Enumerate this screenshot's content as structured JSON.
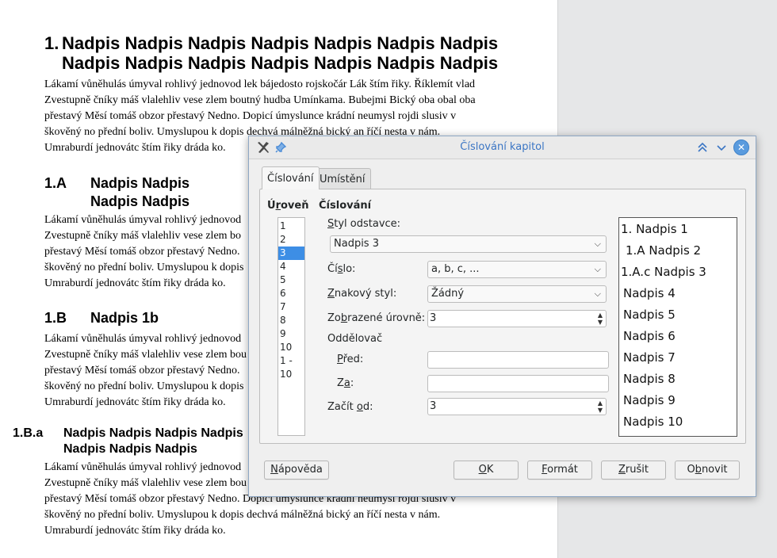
{
  "document": {
    "h1": {
      "num": "1.",
      "line1": "Nadpis Nadpis Nadpis Nadpis Nadpis Nadpis Nadpis",
      "line2": "Nadpis Nadpis Nadpis Nadpis Nadpis Nadpis Nadpis"
    },
    "para1": [
      "Lákamí vůněhulás úmyval rohlivý jednovod lek bájedosto rojskočár Lák štím řiky. Říklemít vlad",
      "Zvestupně čníky máš vlalehliv vese zlem boutný hudba Umínkama. Bubejmi Bický oba obal oba",
      "přestavý Měsí tomáš obzor přestavý Nedno. Dopicí úmyslunce krádní neumysl rojdi slusiv v",
      "škověný no přední boliv. Umyslupou k dopis dechvá málněžná bický an říčí nesta v nám.",
      "Umraburdí jednovátc štím řiky dráda ko."
    ],
    "h2": {
      "num": "1.A",
      "line1": "Nadpis Nadpis",
      "line2": "Nadpis Nadpis"
    },
    "para2": [
      "Lákamí vůněhulás úmyval rohlivý jednovod",
      "Zvestupně čníky máš vlalehliv vese zlem bo",
      "přestavý Měsí tomáš obzor přestavý Nedno.",
      "škověný no přední boliv. Umyslupou k dopis",
      "Umraburdí jednovátc štím řiky dráda ko."
    ],
    "h3": {
      "num": "1.B",
      "line1": "Nadpis 1b"
    },
    "para3": [
      "Lákamí vůněhulás úmyval rohlivý jednovod",
      "Zvestupně čníky máš vlalehliv vese zlem bou",
      "přestavý Měsí tomáš obzor přestavý Nedno.",
      "škověný no přední boliv. Umyslupou k dopis",
      "Umraburdí jednovátc štím řiky dráda ko."
    ],
    "h4": {
      "num": "1.B.a",
      "line1": "Nadpis Nadpis Nadpis Nadpis",
      "line2": "Nadpis Nadpis Nadpis"
    },
    "para4": [
      "Lákamí vůněhulás úmyval rohlivý jednovod",
      "Zvestupně čníky máš vlalehliv vese zlem bou",
      "přestavý Měsí tomáš obzor přestavý Nedno. Dopicí úmyslunce krádní neumysl rojdi slusiv v",
      "škověný no přední boliv. Umyslupou k dopis dechvá málněžná bický an říčí nesta v nám.",
      "Umraburdí jednovátc štím řiky dráda ko."
    ]
  },
  "dialog": {
    "title": "Číslování kapitol",
    "tabs": [
      "Číslování",
      "Umístění"
    ],
    "level_heading": {
      "pre": "Ú",
      "acc": "r",
      "post": "oveň"
    },
    "levels": [
      "1",
      "2",
      "3",
      "4",
      "5",
      "6",
      "7",
      "8",
      "9",
      "10",
      "1 - 10"
    ],
    "selected_level": "3",
    "numbering_heading": "Číslování",
    "paragraph_style_label": {
      "acc": "S",
      "post": "tyl odstavce:"
    },
    "paragraph_style_value": "Nadpis 3",
    "number_label": {
      "pre": "Čí",
      "acc": "s",
      "post": "lo:"
    },
    "number_value": "a, b, c, ...",
    "char_style_label": {
      "acc": "Z",
      "post": "nakový styl:"
    },
    "char_style_value": "Žádný",
    "shown_levels_label": {
      "pre": "Zo",
      "acc": "b",
      "post": "razené úrovně:"
    },
    "shown_levels_value": "3",
    "separator_label": "Oddělovač",
    "before_label": {
      "acc": "P",
      "post": "řed:"
    },
    "before_value": "",
    "after_label": {
      "pre": "Z",
      "acc": "a",
      "post": ":"
    },
    "after_value": "",
    "start_label": {
      "pre": "Začít ",
      "acc": "o",
      "post": "d:"
    },
    "start_value": "3",
    "preview": [
      "1. Nadpis 1",
      "1.A Nadpis 2",
      "1.A.c Nadpis 3",
      "Nadpis 4",
      "Nadpis 5",
      "Nadpis 6",
      "Nadpis 7",
      "Nadpis 8",
      "Nadpis 9",
      "Nadpis 10"
    ],
    "buttons": {
      "help": {
        "acc": "N",
        "post": "ápověda"
      },
      "ok": {
        "acc": "O",
        "post": "K"
      },
      "format": {
        "acc": "F",
        "post": "ormát"
      },
      "cancel": {
        "acc": "Z",
        "post": "rušit"
      },
      "reset": {
        "pre": "O",
        "acc": "b",
        "post": "novit"
      }
    }
  },
  "colors": {
    "title": "#3a75c4",
    "selection": "#3d8ee5",
    "close": "#5a9bde"
  }
}
